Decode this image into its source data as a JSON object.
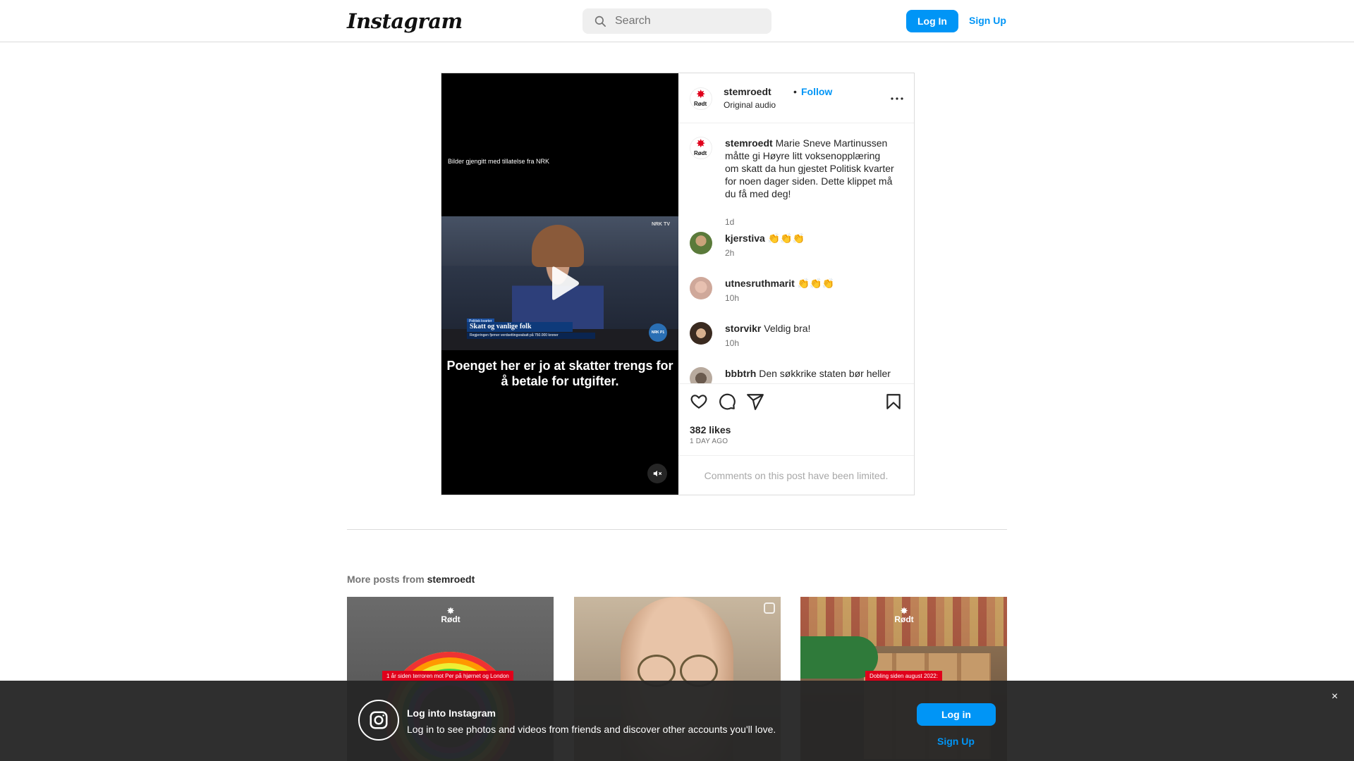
{
  "header": {
    "logo_text": "Instagram",
    "search_placeholder": "Search",
    "login_label": "Log In",
    "signup_label": "Sign Up"
  },
  "post": {
    "video": {
      "credit_text": "Bilder gjengitt med tillatelse fra NRK",
      "channel_tag": "NRK TV",
      "lower_third_tag": "Politisk kvarter",
      "lower_third_title": "Skatt og vanlige folk",
      "lower_third_subtitle": "Regjeringen fjerner verdsettingsrabatt på 750.000 kroner",
      "badge_text": "NRK P1",
      "caption": "Poenget her er jo at skatter trengs for å betale for utgifter."
    },
    "author": {
      "username": "stemroedt",
      "logo_word": "Rødt",
      "follow_label": "Follow",
      "separator": "•",
      "audio": "Original audio"
    },
    "comments": [
      {
        "username": "stemroedt",
        "text": "Marie Sneve Martinussen måtte gi Høyre litt voksenopplæring om skatt da hun gjestet Politisk kvarter for noen dager siden. Dette klippet må du få med deg!",
        "time": "1d"
      },
      {
        "username": "kjerstiva",
        "text": "👏👏👏",
        "time": "2h"
      },
      {
        "username": "utnesruthmarit",
        "text": "👏👏👏",
        "time": "10h"
      },
      {
        "username": "storvikr",
        "text": "Veldig bra!",
        "time": "10h"
      },
      {
        "username": "bbbtrh",
        "text": "Den søkkrike staten bør heller",
        "time": ""
      }
    ],
    "likes": "382 likes",
    "posted_ago": "1 DAY AGO",
    "comments_limited": "Comments on this post have been limited."
  },
  "more_posts": {
    "prefix": "More posts from",
    "username": "stemroedt",
    "thumbs": [
      {
        "logo": "Rødt",
        "banner": "1 år siden terroren mot Per på hjørnet og London"
      },
      {
        "logo": "",
        "banner": ""
      },
      {
        "logo": "Rødt",
        "banner": "Dobling siden august 2022:"
      }
    ]
  },
  "login_banner": {
    "title": "Log into Instagram",
    "text": "Log in to see photos and videos from friends and discover other accounts you'll love.",
    "login_label": "Log in",
    "signup_label": "Sign Up",
    "close_glyph": "×"
  },
  "colors": {
    "accent": "#0095f6",
    "brand_red": "#e0001b",
    "border": "#dbdbdb"
  },
  "icons": [
    "search-icon",
    "more-icon",
    "heart-icon",
    "comment-icon",
    "share-icon",
    "bookmark-icon",
    "play-icon",
    "mute-icon",
    "instagram-icon",
    "close-icon",
    "reel-icon"
  ]
}
